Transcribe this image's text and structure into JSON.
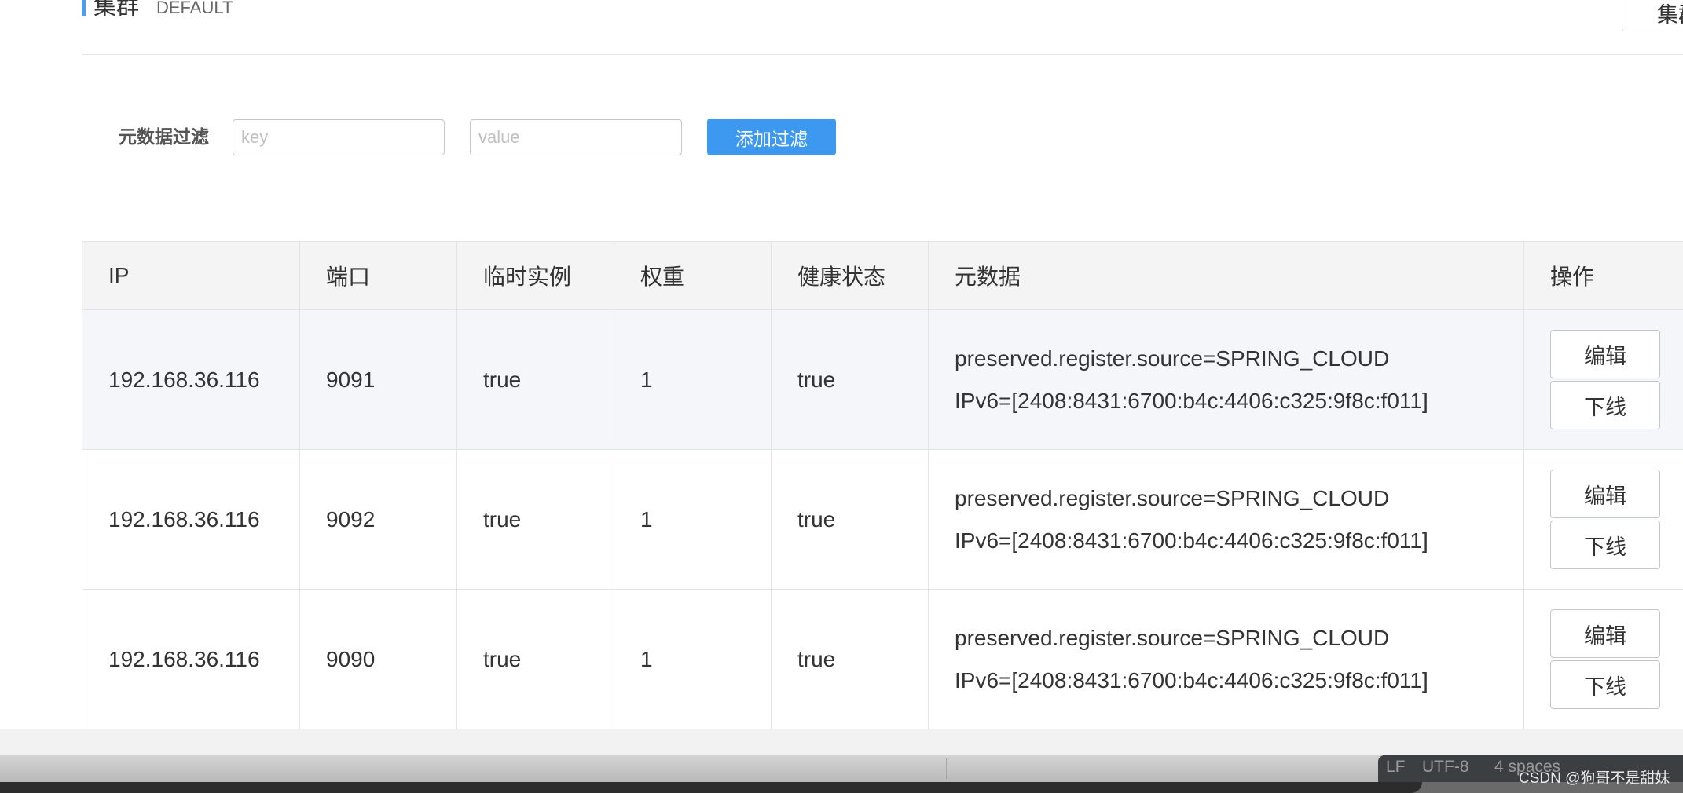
{
  "header": {
    "title": "集群",
    "subtitle": "DEFAULT",
    "right_button_label": "集群"
  },
  "filter": {
    "label": "元数据过滤",
    "key_placeholder": "key",
    "value_placeholder": "value",
    "add_button_label": "添加过滤"
  },
  "table": {
    "columns": [
      "IP",
      "端口",
      "临时实例",
      "权重",
      "健康状态",
      "元数据",
      "操作"
    ],
    "rows": [
      {
        "ip": "192.168.36.116",
        "port": "9091",
        "ephemeral": "true",
        "weight": "1",
        "healthy": "true",
        "metadata": [
          "preserved.register.source=SPRING_CLOUD",
          "IPv6=[2408:8431:6700:b4c:4406:c325:9f8c:f011]"
        ],
        "edit_label": "编辑",
        "offline_label": "下线"
      },
      {
        "ip": "192.168.36.116",
        "port": "9092",
        "ephemeral": "true",
        "weight": "1",
        "healthy": "true",
        "metadata": [
          "preserved.register.source=SPRING_CLOUD",
          "IPv6=[2408:8431:6700:b4c:4406:c325:9f8c:f011]"
        ],
        "edit_label": "编辑",
        "offline_label": "下线"
      },
      {
        "ip": "192.168.36.116",
        "port": "9090",
        "ephemeral": "true",
        "weight": "1",
        "healthy": "true",
        "metadata": [
          "preserved.register.source=SPRING_CLOUD",
          "IPv6=[2408:8431:6700:b4c:4406:c325:9f8c:f011]"
        ],
        "edit_label": "编辑",
        "offline_label": "下线"
      }
    ]
  },
  "status_bar": {
    "line_ending": "LF",
    "encoding": "UTF-8",
    "indent": "4 spaces",
    "watermark": "CSDN @狗哥不是甜妹"
  },
  "colors": {
    "accent": "#3d98f0",
    "header_bg": "#f4f4f5",
    "highlight_row_bg": "#f5f6fa"
  }
}
